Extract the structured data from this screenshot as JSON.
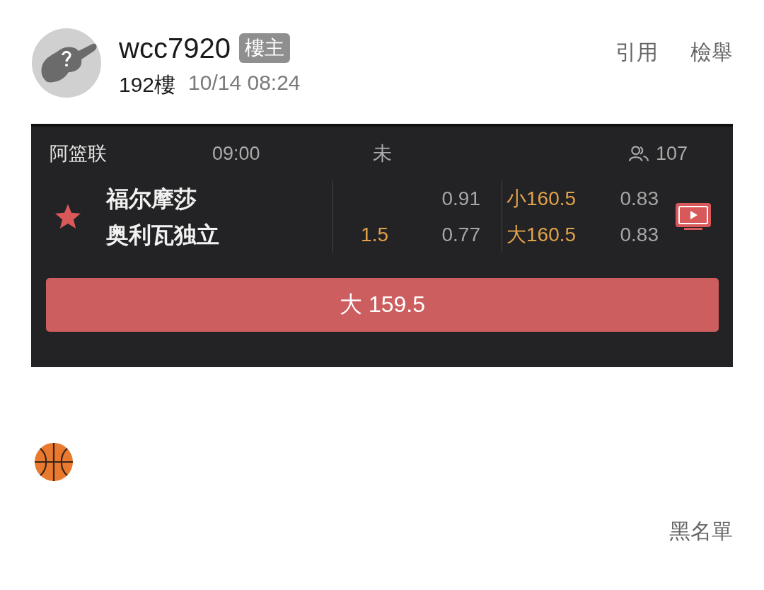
{
  "post": {
    "username": "wcc7920",
    "badge": "樓主",
    "floor": "192樓",
    "time": "10/14 08:24",
    "actions": [
      "引用",
      "檢舉"
    ]
  },
  "match": {
    "league": "阿篮联",
    "time": "09:00",
    "status": "未",
    "viewers": "107",
    "favorite": true,
    "teams": [
      {
        "name": "福尔摩莎",
        "odds": "0.91",
        "total": "小160.5",
        "total_odds": "0.83"
      },
      {
        "name": "奥利瓦独立",
        "handicap": "1.5",
        "odds": "0.77",
        "total": "大160.5",
        "total_odds": "0.83"
      }
    ],
    "bet": "大 159.5"
  },
  "footer": {
    "blacklist": "黑名單"
  }
}
